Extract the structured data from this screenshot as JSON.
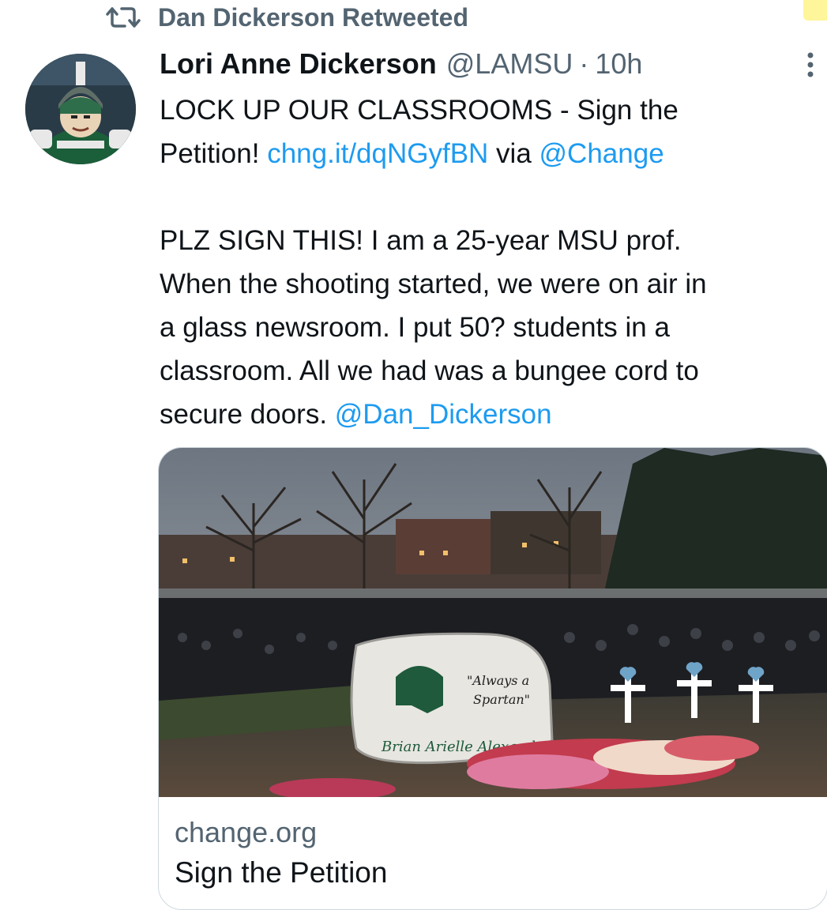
{
  "retweet": {
    "icon": "retweet-icon",
    "label": "Dan Dickerson Retweeted"
  },
  "tweet": {
    "author_name": "Lori Anne Dickerson",
    "handle": "@LAMSU",
    "separator": "·",
    "time": "10h",
    "line1_text": "LOCK UP OUR CLASSROOMS - Sign the",
    "line2_prefix": "Petition! ",
    "link_url": "chng.it/dqNGyfBN",
    "via_text": " via ",
    "mention_change": "@Change",
    "body_lines": [
      "PLZ SIGN THIS! I am a 25-year MSU prof.",
      "When the shooting started, we were on air in",
      "a glass newsroom. I put 50? students in a",
      "classroom. All we had was a bungee cord to"
    ],
    "last_line_prefix": "secure doors. ",
    "mention_dan": "@Dan_Dickerson"
  },
  "card": {
    "domain": "change.org",
    "title": "Sign the Petition",
    "rock_text": {
      "motto_line1": "\"Always a",
      "motto_line2": "Spartan\"",
      "names": "Brian  Arielle  Alexandria"
    }
  },
  "colors": {
    "link": "#1d9bf0",
    "secondary_text": "#536471",
    "primary_text": "#0f1419"
  }
}
